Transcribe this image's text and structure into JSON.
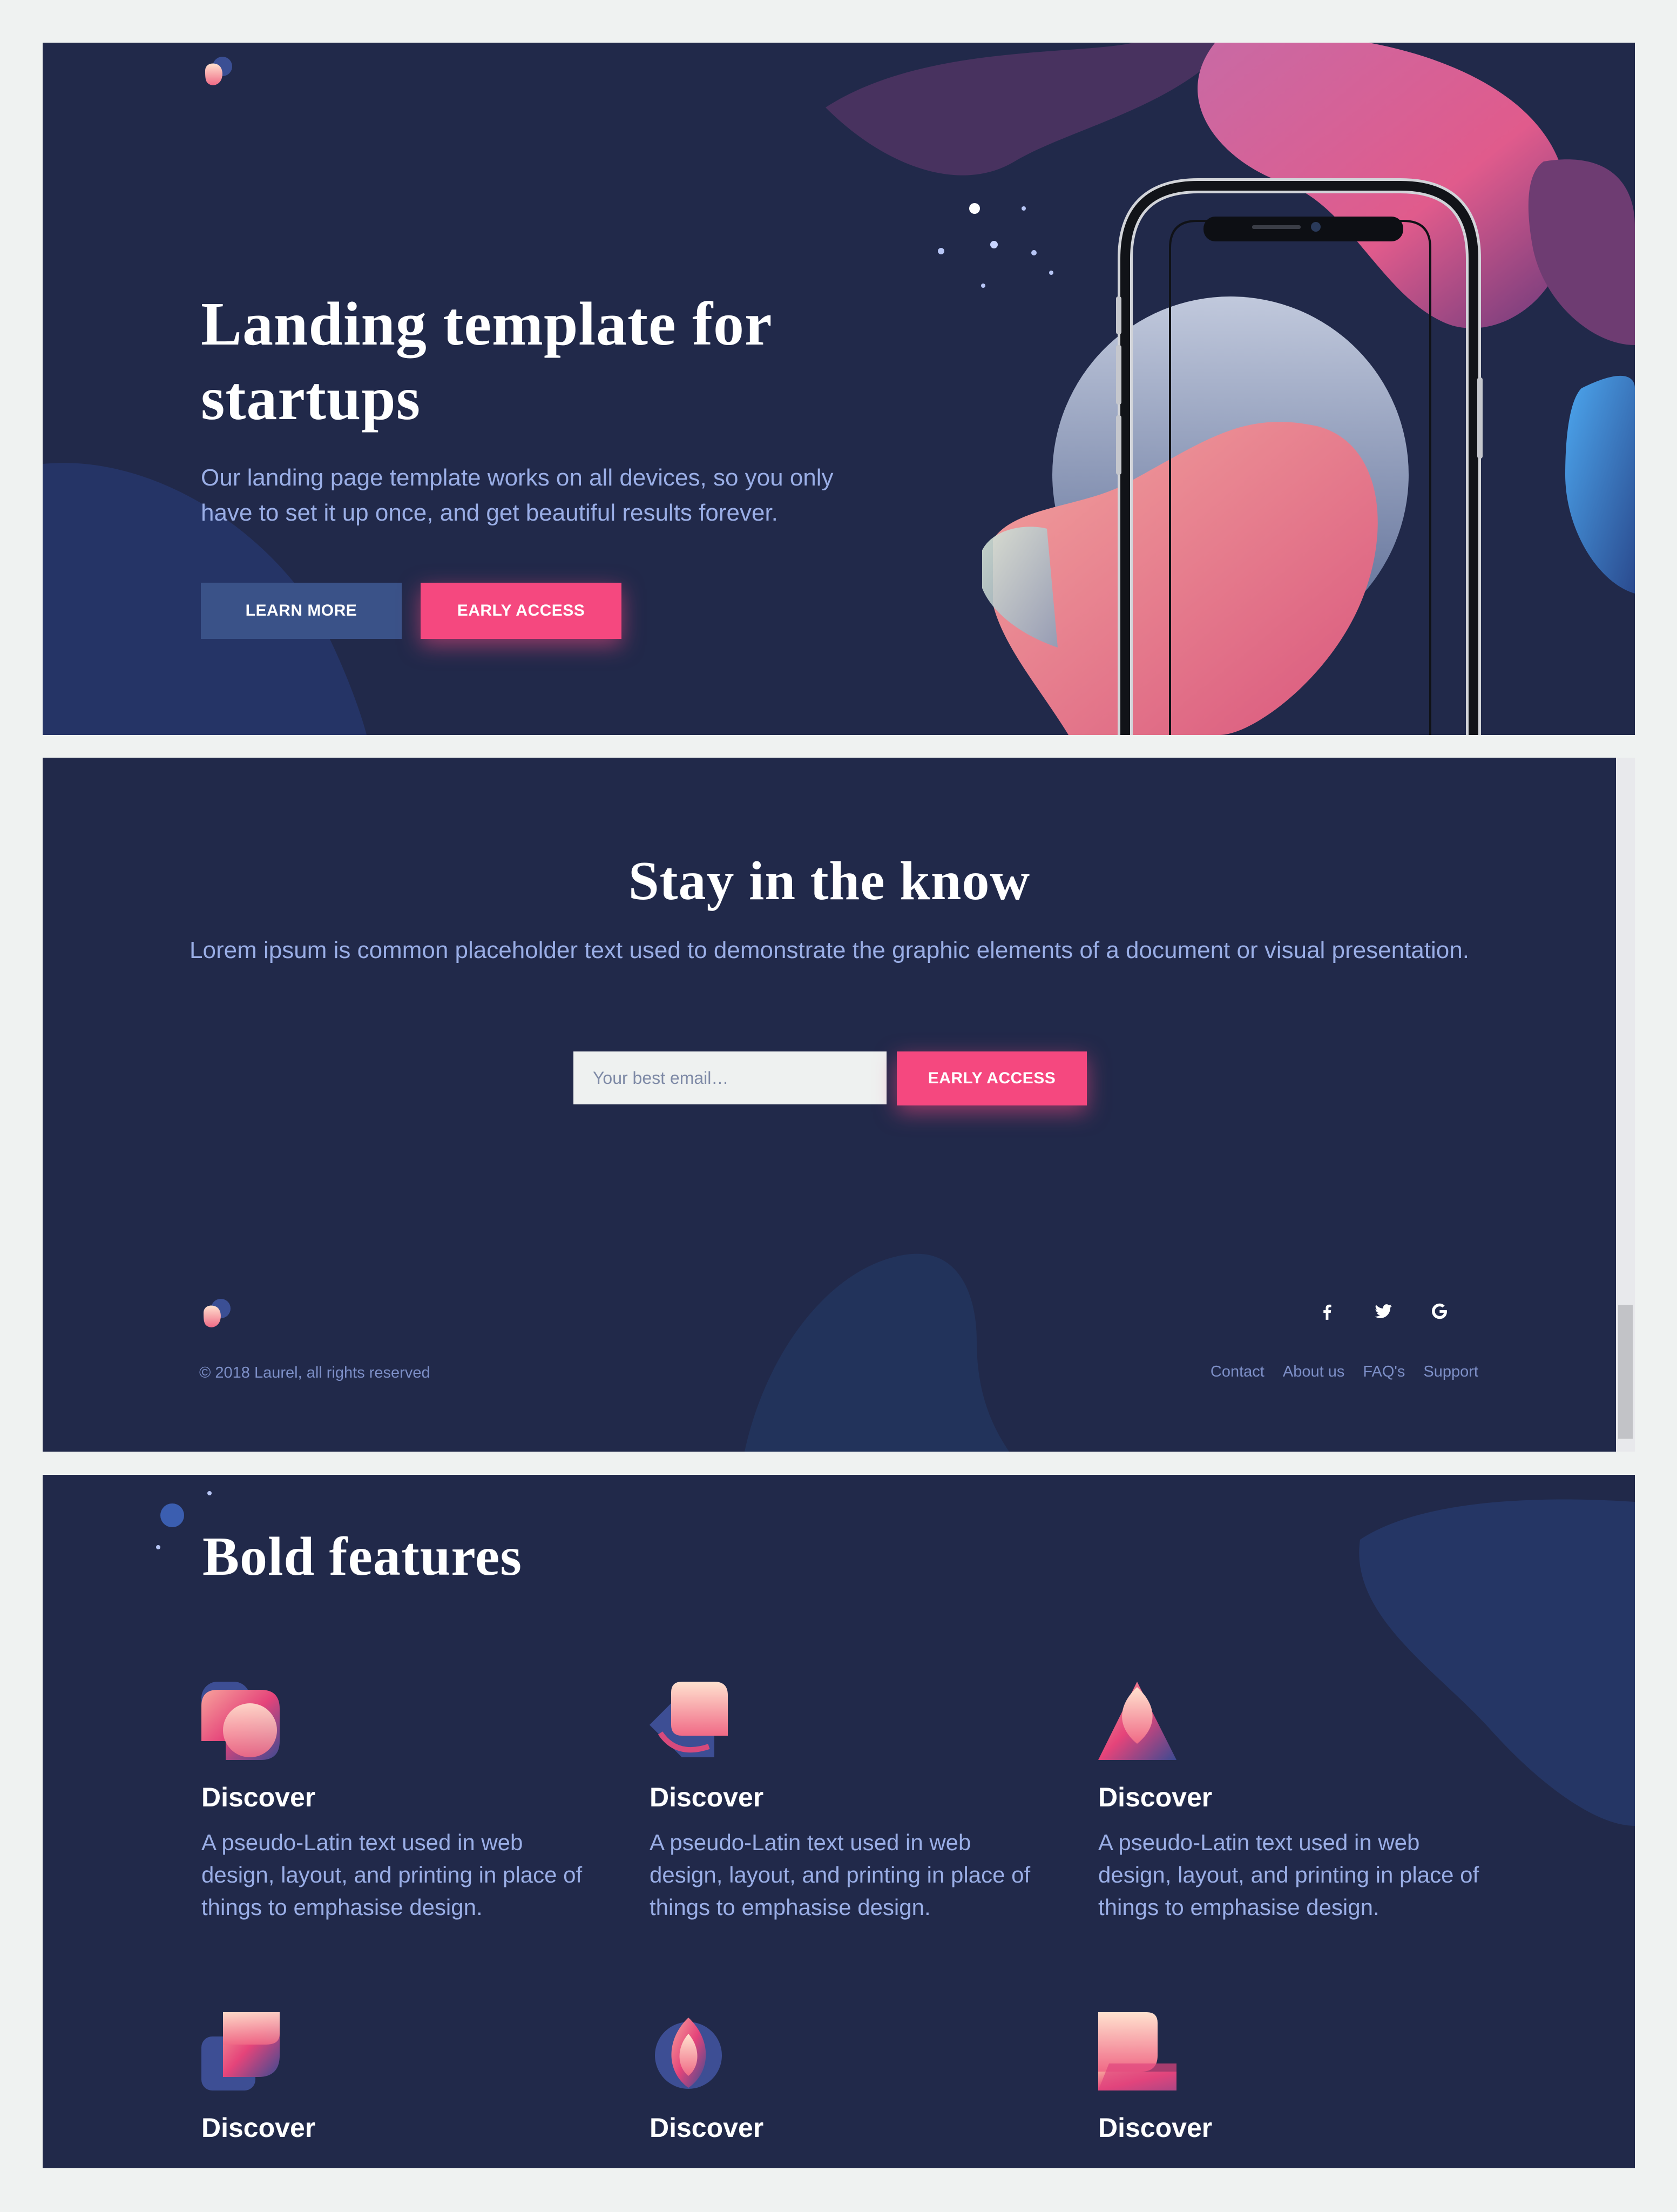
{
  "hero": {
    "title": "Landing template for startups",
    "description": "Our landing page template works on all devices, so you only have to set it up once, and get beautiful results forever.",
    "learn_more_label": "LEARN MORE",
    "early_access_label": "EARLY ACCESS"
  },
  "newsletter": {
    "title": "Stay in the know",
    "description": "Lorem ipsum is common placeholder text used to demonstrate the graphic elements of a document or visual presentation.",
    "email_placeholder": "Your best email…",
    "submit_label": "EARLY ACCESS"
  },
  "footer": {
    "copyright": "© 2018 Laurel, all rights reserved",
    "links": [
      "Contact",
      "About us",
      "FAQ's",
      "Support"
    ],
    "social_icons": [
      "facebook-icon",
      "twitter-icon",
      "google-icon"
    ]
  },
  "features": {
    "title": "Bold features",
    "items": [
      {
        "title": "Discover",
        "description": "A pseudo-Latin text used in web design, layout, and printing in place of things to emphasise design.",
        "icon": "feature-icon-1"
      },
      {
        "title": "Discover",
        "description": "A pseudo-Latin text used in web design, layout, and printing in place of things to emphasise design.",
        "icon": "feature-icon-2"
      },
      {
        "title": "Discover",
        "description": "A pseudo-Latin text used in web design, layout, and printing in place of things to emphasise design.",
        "icon": "feature-icon-3"
      },
      {
        "title": "Discover",
        "icon": "feature-icon-4"
      },
      {
        "title": "Discover",
        "icon": "feature-icon-5"
      },
      {
        "title": "Discover",
        "icon": "feature-icon-6"
      }
    ]
  },
  "colors": {
    "background": "#21294a",
    "accent_pink": "#f5487f",
    "button_dark": "#3a5288",
    "text_muted": "#9aaee6",
    "page_bg": "#eff2f1"
  }
}
